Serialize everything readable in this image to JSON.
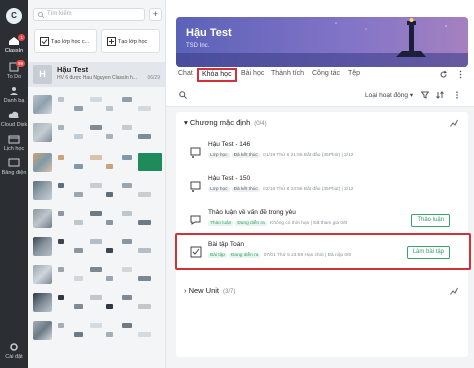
{
  "rail": {
    "avatar_letter": "C",
    "items": [
      {
        "label": "ClassIn",
        "badge": "1"
      },
      {
        "label": "To Do",
        "badge": "99"
      },
      {
        "label": "Danh bạ",
        "badge": ""
      },
      {
        "label": "Cloud Disk",
        "badge": ""
      },
      {
        "label": "Lịch học",
        "badge": ""
      },
      {
        "label": "Bảng điện",
        "badge": ""
      }
    ],
    "settings_label": "Cài đặt"
  },
  "list": {
    "search_placeholder": "Tìm kiếm",
    "plus": "+",
    "create_class": "Tạo lớp học c...",
    "create_class2": "Tạo lớp học",
    "selected": {
      "title": "Hậu Test",
      "subtitle": "HV 6 được Hau Nguyen ClassIn h...",
      "date": "06/29",
      "avatar_letter": "H"
    }
  },
  "main": {
    "banner_title": "Hậu Test",
    "banner_sub": "TSD Inc.",
    "tabs": [
      "Chat",
      "Khóa học",
      "Bài học",
      "Thành tích",
      "Công tác",
      "Tệp"
    ],
    "sort_label": "Loại hoạt động",
    "sections": [
      {
        "title": "Chương mặc định",
        "count": "(0/4)"
      },
      {
        "title": "New Unit",
        "count": "(3/7)"
      }
    ],
    "items": [
      {
        "title": "Hậu Test - 146",
        "tags": [
          "Lớp học",
          "Đã kết thúc"
        ],
        "meta": "01/19 Thứ 6 21:55 Bắt đầu (35Phút)  |  2/12"
      },
      {
        "title": "Hậu Test - 150",
        "tags": [
          "Lớp học",
          "Đã kết thúc"
        ],
        "meta": "02/16 Thứ 6 23:55 Bắt đầu (35Phút)  |  2/12"
      },
      {
        "title": "Thảo luận về vấn đề trong yêu",
        "tags": [
          "Thảo luận",
          "Đang diễn ra"
        ],
        "meta": "Không có thời hạn  |  Đã tham gia 0/8",
        "button": "Thảo luận"
      },
      {
        "title": "Bài tập Toán",
        "tags": [
          "Bài tập",
          "Đang diễn ra"
        ],
        "meta": "07/01 Thứ 5 23:59 Hạn chót  |  Đã nộp 0/8",
        "button": "Làm bài tập"
      }
    ]
  },
  "colors": {
    "accent": "#3aa36b",
    "highlight": "#d0323a",
    "rail": "#2b2f33"
  }
}
